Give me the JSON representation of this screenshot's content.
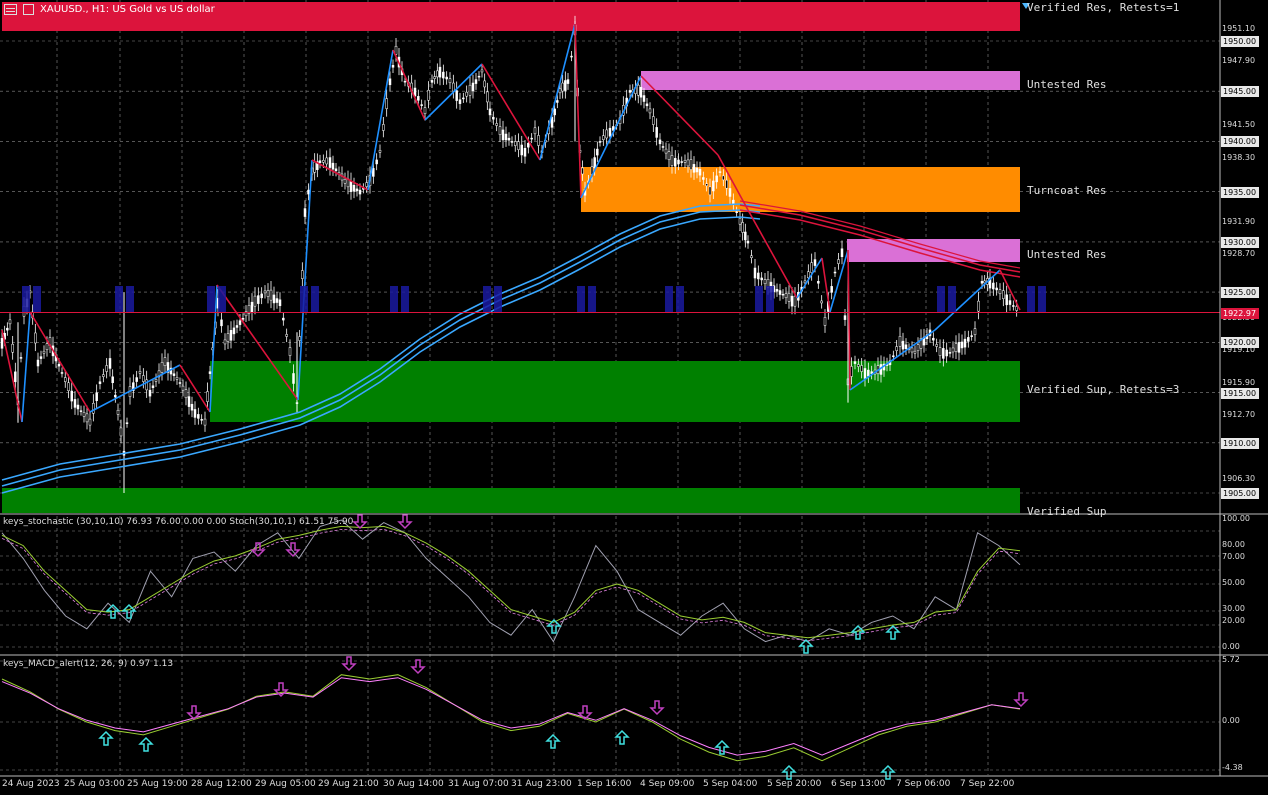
{
  "header": {
    "symbol_title": "XAUUSD., H1: US Gold vs US dollar"
  },
  "zones": [
    {
      "label": "Verified Res, Retests=1",
      "color": "#dc143c"
    },
    {
      "label": "Untested Res",
      "color": "#da70d6"
    },
    {
      "label": "Turncoat Res",
      "color": "#ff8c00"
    },
    {
      "label": "Untested Res",
      "color": "#da70d6"
    },
    {
      "label": "Verified Sup, Retests=3",
      "color": "#008000"
    },
    {
      "label": "Verified Sup",
      "color": "#008000"
    }
  ],
  "price_axis": {
    "ticks": [
      "1951.10",
      "1947.90",
      "1941.50",
      "1938.30",
      "1931.90",
      "1928.70",
      "1922.30",
      "1919.10",
      "1915.90",
      "1912.70",
      "1906.30"
    ],
    "boxed": [
      {
        "text": "1950.00",
        "kind": "level"
      },
      {
        "text": "1945.00",
        "kind": "level"
      },
      {
        "text": "1940.00",
        "kind": "level"
      },
      {
        "text": "1935.00",
        "kind": "level"
      },
      {
        "text": "1930.00",
        "kind": "level"
      },
      {
        "text": "1925.00",
        "kind": "level"
      },
      {
        "text": "1922.97",
        "kind": "current"
      },
      {
        "text": "1920.00",
        "kind": "level"
      },
      {
        "text": "1915.00",
        "kind": "level"
      },
      {
        "text": "1910.00",
        "kind": "level"
      },
      {
        "text": "1905.00",
        "kind": "level"
      }
    ],
    "current_price": 1922.97
  },
  "stochastic": {
    "label": "keys_stochastic (30,10,10) 76.93 76.00 0.00 0.00 Stoch(30,10,1) 61.51 75.90",
    "ticks": [
      "100.00",
      "80.00",
      "70.00",
      "50.00",
      "30.00",
      "20.00",
      "0.00"
    ]
  },
  "macd": {
    "label": "keys_MACD_alert(12, 26, 9) 0.97 1.13",
    "ticks": [
      "5.72",
      "0.00",
      "-4.38"
    ]
  },
  "time_axis": [
    "24 Aug 2023",
    "25 Aug 03:00",
    "25 Aug 19:00",
    "28 Aug 12:00",
    "29 Aug 05:00",
    "29 Aug 21:00",
    "30 Aug 14:00",
    "31 Aug 07:00",
    "31 Aug 23:00",
    "1 Sep 16:00",
    "4 Sep 09:00",
    "5 Sep 04:00",
    "5 Sep 20:00",
    "6 Sep 13:00",
    "7 Sep 06:00",
    "7 Sep 22:00"
  ],
  "colors": {
    "background": "#000000",
    "grid": "#8a8a8a",
    "bull_candle": "#ffffff",
    "zigzag_up": "#1e90ff",
    "zigzag_down": "#dc143c",
    "ma": "#4fb8ff",
    "signal_up": "#40e0e0",
    "signal_down": "#c040c0"
  }
}
